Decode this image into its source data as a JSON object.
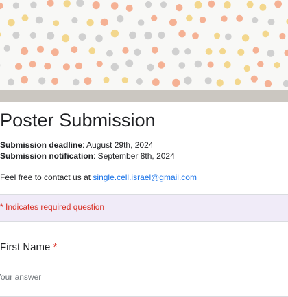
{
  "form": {
    "title": "Poster Submission",
    "deadline": {
      "label": "Submission deadline",
      "value": ": August 29th, 2024"
    },
    "notification": {
      "label": "Submission notification",
      "value": ": September 8th, 2024"
    },
    "contact_text": "Feel free to contact us at ",
    "contact_email": "single.cell.israel@gmail.com",
    "required_note": "* Indicates required question"
  },
  "question": {
    "title": "First Name",
    "required_mark": "*",
    "placeholder": "Your answer"
  },
  "colors": {
    "background": "#f0ebf8",
    "required": "#d93025",
    "link": "#1a73e8",
    "banner_dots": [
      "#f4a582",
      "#f2d17a",
      "#c9c9c9"
    ]
  },
  "icons": {
    "banner": "confetti-dots-pattern"
  }
}
